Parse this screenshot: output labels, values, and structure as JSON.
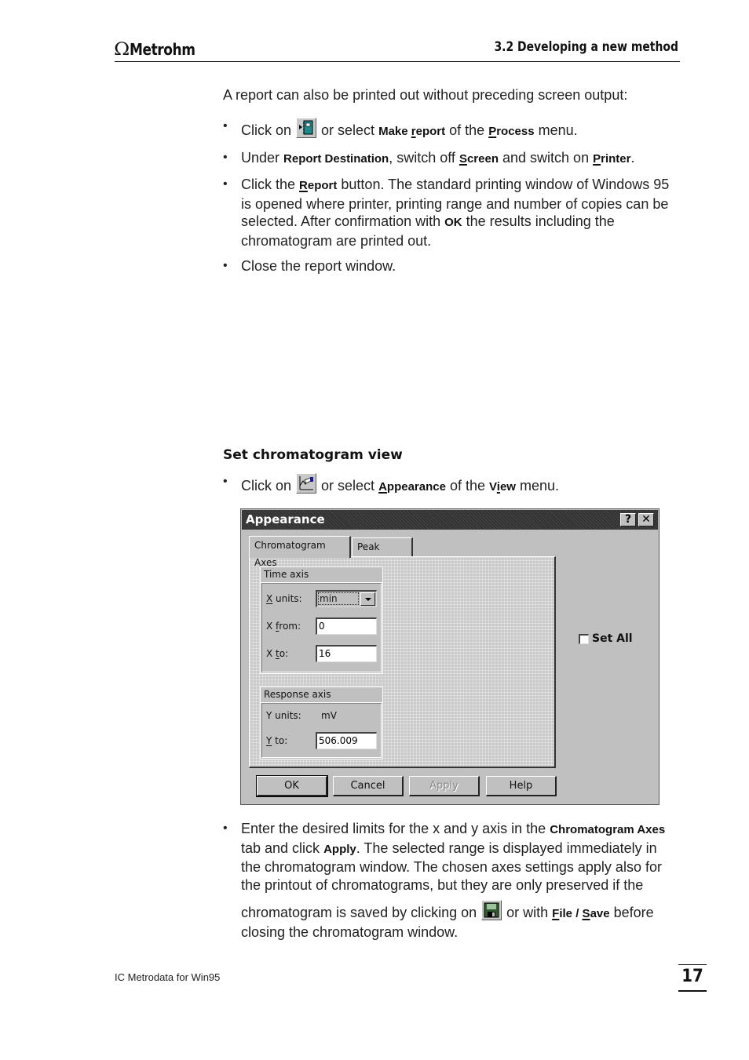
{
  "header": {
    "logo_symbol": "Ω",
    "logo_text": "Metrohm",
    "section_title": "3.2  Developing a new method"
  },
  "intro": "A report can also be printed out without preceding screen output:",
  "steps1": [
    {
      "pre": "Click on",
      "icon": "make-report-icon",
      "mid": "or select",
      "b1": "Make report",
      "mid2": "of the",
      "b2": "Process",
      "post": "menu."
    },
    {
      "pre": "Under",
      "b1": "Report Destination",
      "mid": ", switch off",
      "b2": "Screen",
      "mid2": "and switch on",
      "b3": "Printer",
      "post": "."
    },
    {
      "pre": "Click the",
      "b1": "Report",
      "post1": "button. The standard printing window of Windows 95 is opened where printer, printing range and number of copies can be selected. After confirmation with",
      "b2": "OK",
      "post2": "the results including the chromatogram are printed out."
    },
    {
      "text": "Close the report window."
    }
  ],
  "heading": "Set chromatogram view",
  "step2": {
    "pre": "Click on",
    "icon": "appearance-icon",
    "mid": "or select",
    "b1": "Appearance",
    "mid2": "of the",
    "b2": "View",
    "post": "menu."
  },
  "dialog": {
    "title": "Appearance",
    "help_button": "?",
    "close_button": "✕",
    "tabs": [
      "Chromatogram Axes",
      "Peak Label"
    ],
    "time_axis": {
      "label": "Time axis",
      "x_units_label": "X units:",
      "x_units_value": "min",
      "x_from_label": "X from:",
      "x_from_value": "0",
      "x_to_label": "X to:",
      "x_to_value": "16"
    },
    "response_axis": {
      "label": "Response axis",
      "y_units_label": "Y units:",
      "y_units_value": "mV",
      "y_to_label": "Y to:",
      "y_to_value": "506.009"
    },
    "set_all_label": "Set All",
    "set_all_checked": false,
    "buttons": {
      "ok": "OK",
      "cancel": "Cancel",
      "apply": "Apply",
      "help": "Help"
    }
  },
  "step3": {
    "pre": "Enter the desired limits for the x and y axis in the",
    "b1": "Chromatogram Axes",
    "mid": "tab and click",
    "b2": "Apply",
    "mid2": ". The selected range is displayed immediately in the chromatogram window. The chosen axes settings apply also for the printout of chromatograms, but they are only preserved if the chromatogram is saved by clicking on",
    "icon": "save-icon",
    "mid3": "or with",
    "b3": "File",
    "sep": " / ",
    "b4": "Save",
    "post": "before closing the chromatogram window."
  },
  "footer": {
    "left": "IC Metrodata for Win95",
    "page_number": "17"
  }
}
